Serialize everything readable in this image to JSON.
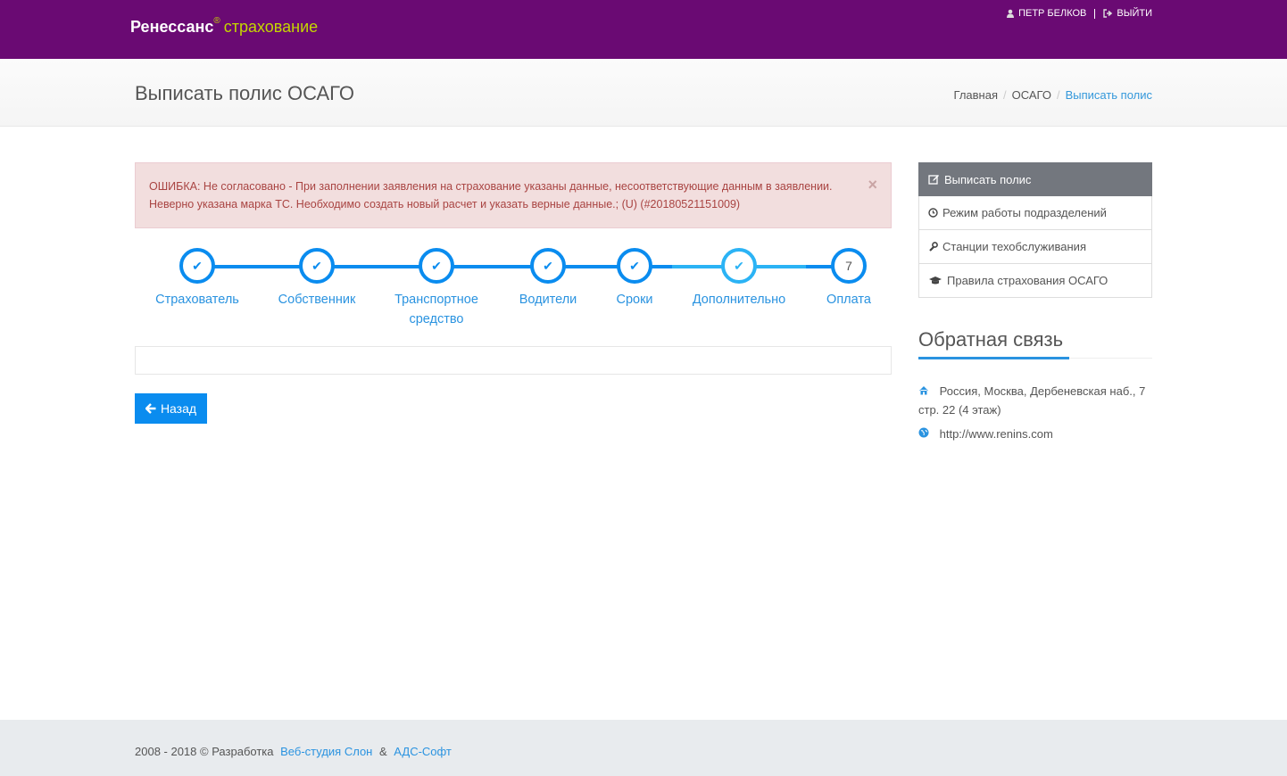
{
  "header": {
    "logo_part1": "Ренессанс",
    "logo_reg": "®",
    "logo_part2": "страхование",
    "user_name": "ПЕТР БЕЛКОВ",
    "logout_label": "ВЫЙТИ"
  },
  "page": {
    "title": "Выписать полис ОСАГО",
    "breadcrumb": [
      {
        "label": "Главная"
      },
      {
        "label": "ОСАГО"
      },
      {
        "label": "Выписать полис"
      }
    ],
    "breadcrumb_sep": "/"
  },
  "alert": {
    "text": "ОШИБКА: Не согласовано - При заполнении заявления на страхование указаны данные, несоответствующие данным в заявлении. Неверно указана марка ТС. Необходимо создать новый расчет и указать верные данные.; (U) (#20180521151009)",
    "close": "×"
  },
  "steps": [
    {
      "label": "Страхователь",
      "state": "done",
      "mark": "✔"
    },
    {
      "label": "Собственник",
      "state": "done",
      "mark": "✔"
    },
    {
      "label": "Транспортное средство",
      "state": "done",
      "mark": "✔"
    },
    {
      "label": "Водители",
      "state": "done",
      "mark": "✔"
    },
    {
      "label": "Сроки",
      "state": "done",
      "mark": "✔"
    },
    {
      "label": "Дополнительно",
      "state": "done-light",
      "mark": "✔"
    },
    {
      "label": "Оплата",
      "state": "todo",
      "mark": "7"
    }
  ],
  "back_button": "Назад",
  "sidebar": {
    "menu": [
      {
        "label": "Выписать полис",
        "icon": "edit-icon",
        "active": true
      },
      {
        "label": "Режим работы подразделений",
        "icon": "clock-icon",
        "active": false
      },
      {
        "label": "Станции техобслуживания",
        "icon": "wrench-icon",
        "active": false
      },
      {
        "label": "Правила страхования ОСАГО",
        "icon": "graduation-cap-icon",
        "active": false
      }
    ],
    "feedback_title": "Обратная связь",
    "address": "Россия, Москва, Дербеневская наб., 7 стр. 22 (4 этаж)",
    "website": "http://www.renins.com"
  },
  "footer": {
    "prefix": "2008 - 2018 © Разработка",
    "link1": "Веб-студия Слон",
    "amp": "&",
    "link2": "АДС-Софт"
  },
  "colors": {
    "brand": "#6a0a73",
    "accent": "#0a8cef",
    "logo_green": "#c4d600"
  }
}
